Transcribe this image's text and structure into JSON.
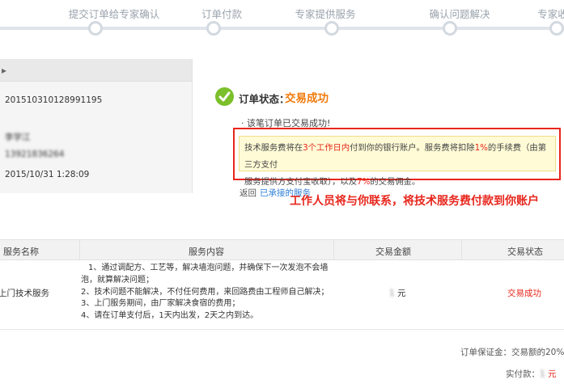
{
  "steps": [
    {
      "label": "提交订单给专家确认"
    },
    {
      "label": "订单付款"
    },
    {
      "label": "专家提供服务"
    },
    {
      "label": "确认问题解决"
    },
    {
      "label": "专家收"
    }
  ],
  "order": {
    "order_no": "201510310128991195",
    "contact_name": "李学江",
    "contact_phone": "13921836264",
    "created_time": "2015/10/31 1:28:09"
  },
  "status": {
    "label": "订单状态：",
    "value": "交易成功",
    "note": "· 该笔订单已交易成功!"
  },
  "notice": {
    "p1": "技术服务费将在",
    "p2": "3个工作日内",
    "p3": "付到你的银行账户。服务费将扣除",
    "p4": "1%",
    "p5": "的手续费（由第三方支付",
    "p6": "服务提供方支付宝收取），以及",
    "p7": "7%",
    "p8": "的交易佣金。"
  },
  "back": {
    "label": "返回",
    "link": "已承接的服务"
  },
  "annotation": "工作人员将与你联系，将技术服务费付款到你账户",
  "table": {
    "headers": {
      "name": "服务名称",
      "content": "服务内容",
      "amount": "交易金额",
      "status": "交易状态"
    },
    "row": {
      "name": "上门技术服务",
      "content": [
        "1、通过调配方、工艺等，解决墙泡问题，并确保下一次发泡不会墙",
        "泡，就算解决问题；",
        "2、技术问题不能解决，不付任何费用，来回路费由工程师自己解决；",
        "3、上门服务期间，由厂家解决食宿的费用；",
        "4、请在订单支付后，1天内出发，2天之内到达。"
      ],
      "amount_value": "1",
      "amount_unit": "元",
      "status": "交易成功"
    }
  },
  "footer": {
    "deposit_label": "订单保证金：",
    "deposit_value": "交易额的20%",
    "paid_label": "实付款：",
    "paid_value": "1",
    "paid_unit": "元"
  },
  "colors": {
    "accent_orange": "#f07a0c",
    "alert_red": "#e8261c",
    "link_blue": "#2d7ed6",
    "success_green": "#7bbf2a"
  },
  "icons": {
    "status": "check-circle-icon"
  }
}
